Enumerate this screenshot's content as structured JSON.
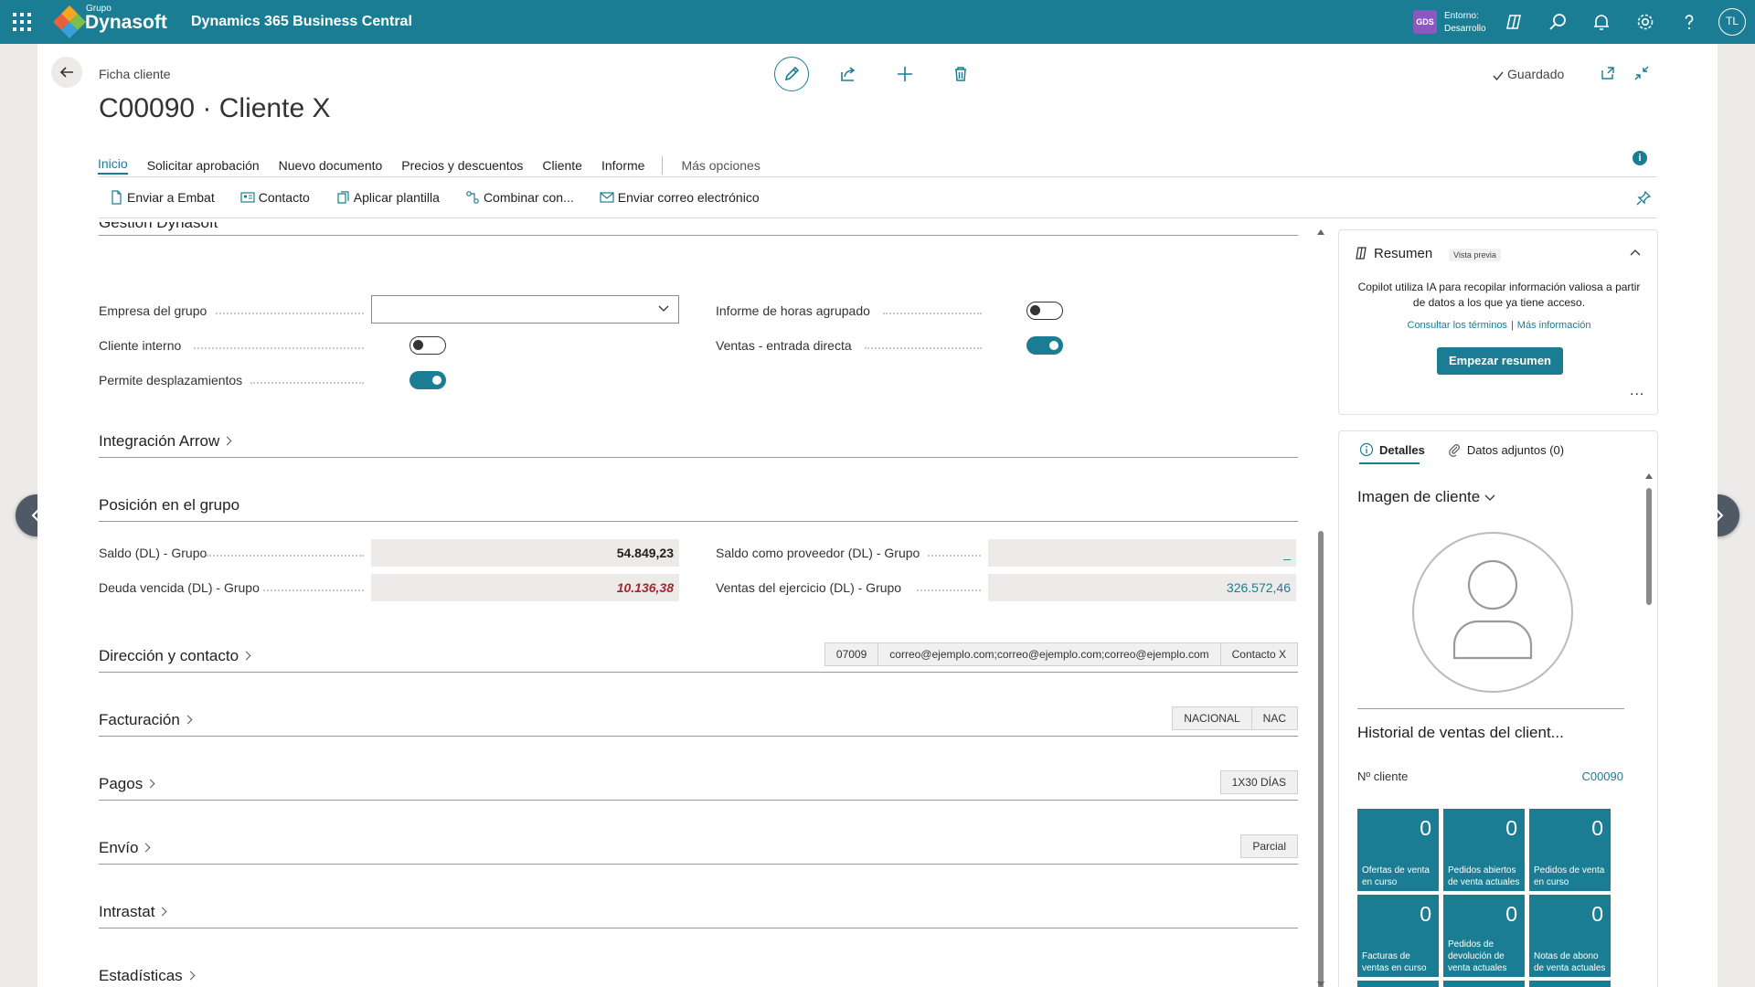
{
  "topbar": {
    "brand_small": "Grupo",
    "brand": "Dynasoft",
    "app_title": "Dynamics 365 Business Central",
    "env_badge": "GDS",
    "env_label": "Entorno:",
    "env_value": "Desarrollo",
    "avatar": "TL"
  },
  "page": {
    "breadcrumb": "Ficha cliente",
    "title": "C00090 · Cliente X",
    "saved_label": "Guardado"
  },
  "tabs": {
    "items": [
      "Inicio",
      "Solicitar aprobación",
      "Nuevo documento",
      "Precios y descuentos",
      "Cliente",
      "Informe"
    ],
    "more": "Más opciones"
  },
  "toolbar": {
    "items": [
      "Enviar a Embat",
      "Contacto",
      "Aplicar plantilla",
      "Combinar con...",
      "Enviar correo electrónico"
    ]
  },
  "gestion": {
    "title_cut": "Gestión Dynasoft",
    "fields": {
      "empresa_grupo": {
        "label": "Empresa del grupo",
        "value": ""
      },
      "cliente_interno": {
        "label": "Cliente interno",
        "on": false
      },
      "permite_desplazamientos": {
        "label": "Permite desplazamientos",
        "on": true
      },
      "informe_horas": {
        "label": "Informe de horas agrupado",
        "on": false
      },
      "ventas_entrada": {
        "label": "Ventas - entrada directa",
        "on": true
      }
    }
  },
  "sections": {
    "integracion": "Integración Arrow",
    "posicion": "Posición en el grupo",
    "direccion": "Dirección y contacto",
    "facturacion": "Facturación",
    "pagos": "Pagos",
    "envio": "Envío",
    "intrastat": "Intrastat",
    "estadisticas": "Estadísticas"
  },
  "posicion": {
    "saldo_label": "Saldo (DL) - Grupo",
    "saldo_value": "54.849,23",
    "deuda_label": "Deuda vencida (DL) - Grupo",
    "deuda_value": "10.136,38",
    "saldo_prov_label": "Saldo como proveedor (DL) - Grupo",
    "saldo_prov_value": "_",
    "ventas_label": "Ventas del ejercicio (DL) - Grupo",
    "ventas_value": "326.572,46"
  },
  "pills": {
    "direccion": [
      "07009",
      "correo@ejemplo.com;correo@ejemplo.com;correo@ejemplo.com",
      "Contacto X"
    ],
    "facturacion": [
      "NACIONAL",
      "NAC"
    ],
    "pagos": [
      "1X30 DÍAS"
    ],
    "envio": [
      "Parcial"
    ]
  },
  "resumen": {
    "title": "Resumen",
    "badge": "Vista previa",
    "text": "Copilot utiliza IA para recopilar información valiosa a partir de datos a los que ya tiene acceso.",
    "link1": "Consultar los términos",
    "link2": "Más información",
    "button": "Empezar resumen",
    "more": "..."
  },
  "factbox": {
    "tab_details": "Detalles",
    "tab_attachments": "Datos adjuntos (0)",
    "image_title": "Imagen de cliente",
    "history_title": "Historial de ventas del client...",
    "customer_no_label": "Nº cliente",
    "customer_no_value": "C00090",
    "tiles": [
      {
        "value": "0",
        "label": "Ofertas de venta en curso"
      },
      {
        "value": "0",
        "label": "Pedidos abiertos de venta actuales"
      },
      {
        "value": "0",
        "label": "Pedidos de venta en curso"
      },
      {
        "value": "0",
        "label": "Facturas de ventas en curso"
      },
      {
        "value": "0",
        "label": "Pedidos de devolución de venta actuales"
      },
      {
        "value": "0",
        "label": "Notas de abono de venta actuales"
      }
    ]
  },
  "colors": {
    "accent": "#1b7d93",
    "negative": "#a4262c",
    "env_badge": "#8b58c2"
  }
}
